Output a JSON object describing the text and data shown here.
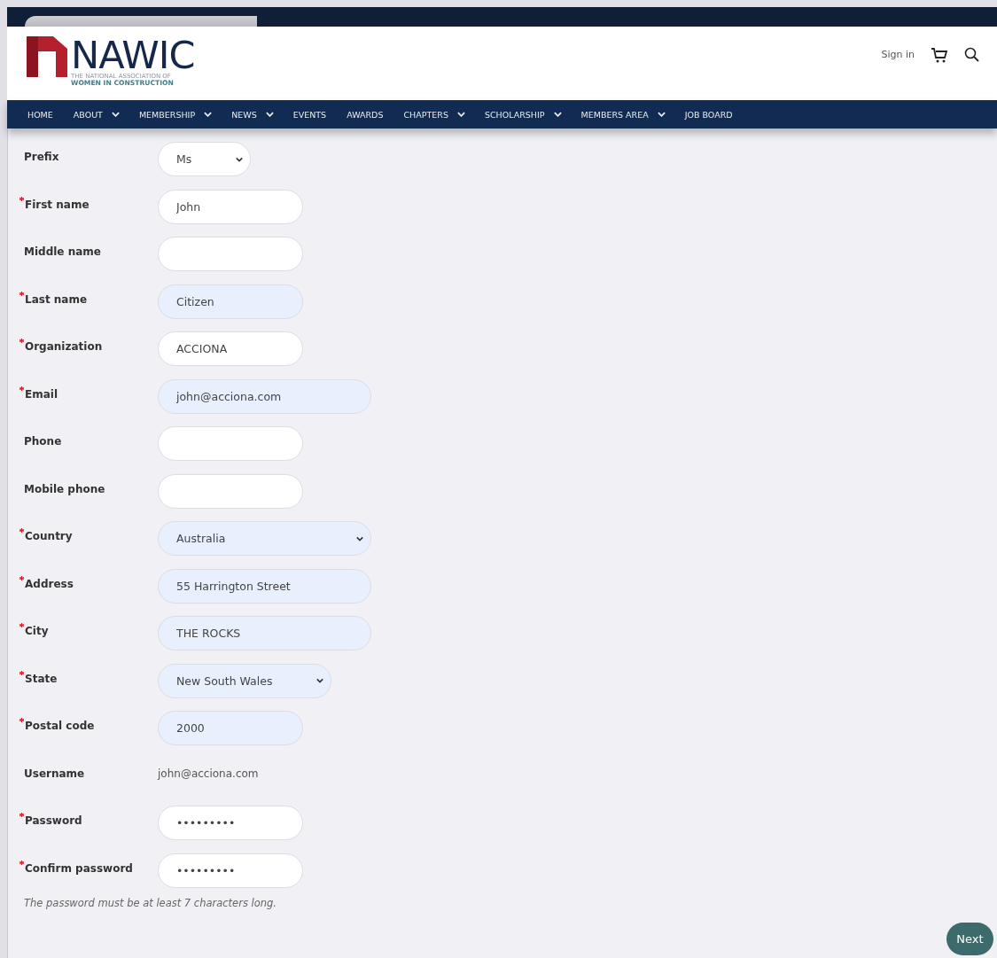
{
  "header": {
    "logo": {
      "name": "NAWIC",
      "tagline_1": "THE NATIONAL ASSOCIATION OF",
      "tagline_2": "WOMEN IN CONSTRUCTION"
    },
    "sign_in": "Sign in"
  },
  "nav": [
    {
      "label": "HOME",
      "has_menu": false
    },
    {
      "label": "ABOUT",
      "has_menu": true
    },
    {
      "label": "MEMBERSHIP",
      "has_menu": true
    },
    {
      "label": "NEWS",
      "has_menu": true
    },
    {
      "label": "EVENTS",
      "has_menu": false
    },
    {
      "label": "AWARDS",
      "has_menu": false
    },
    {
      "label": "CHAPTERS",
      "has_menu": true
    },
    {
      "label": "SCHOLARSHIP",
      "has_menu": true
    },
    {
      "label": "MEMBERS AREA",
      "has_menu": true
    },
    {
      "label": "JOB BOARD",
      "has_menu": false
    }
  ],
  "form": {
    "fields": [
      {
        "label": "Prefix",
        "required": false,
        "kind": "select",
        "value": "Ms",
        "autofilled": false
      },
      {
        "label": "First name",
        "required": true,
        "kind": "input",
        "value": "John",
        "wide": false,
        "autofilled": false
      },
      {
        "label": "Middle name",
        "required": false,
        "kind": "input",
        "wide": false,
        "autofilled": false
      },
      {
        "label": "Last name",
        "required": true,
        "kind": "input",
        "value": "Citizen",
        "wide": false,
        "autofilled": true
      },
      {
        "label": "Organization",
        "required": true,
        "kind": "input",
        "value": "ACCIONA",
        "wide": false,
        "autofilled": false
      },
      {
        "label": "Email",
        "required": true,
        "kind": "input",
        "value": "john@acciona.com",
        "wide": true,
        "autofilled": true
      },
      {
        "label": "Phone",
        "required": false,
        "kind": "input",
        "wide": false,
        "autofilled": false
      },
      {
        "label": "Mobile phone",
        "required": false,
        "kind": "input",
        "wide": false,
        "autofilled": false
      },
      {
        "label": "Country",
        "required": true,
        "kind": "select",
        "value": "Australia",
        "wide": true,
        "autofilled": true
      },
      {
        "label": "Address",
        "required": true,
        "kind": "input",
        "value": "55 Harrington Street",
        "wide": true,
        "autofilled": true
      },
      {
        "label": "City",
        "required": true,
        "kind": "input",
        "value": "THE ROCKS",
        "wide": true,
        "autofilled": true
      },
      {
        "label": "State",
        "required": true,
        "kind": "select",
        "value": "New South Wales",
        "autofilled": true
      },
      {
        "label": "Postal code",
        "required": true,
        "kind": "input",
        "value": "2000",
        "wide": false,
        "autofilled": true
      },
      {
        "label": "Username",
        "kind": "text",
        "value": "john@acciona.com"
      },
      {
        "label": "Password",
        "required": true,
        "kind": "input",
        "value": "•••••••••",
        "wide": false,
        "autofilled": false
      },
      {
        "label": "Confirm password",
        "required": true,
        "kind": "input",
        "value": "•••••••••",
        "wide": false,
        "autofilled": false
      }
    ],
    "hint": "The password must be at least 7 characters long.",
    "next_button": "Next"
  }
}
